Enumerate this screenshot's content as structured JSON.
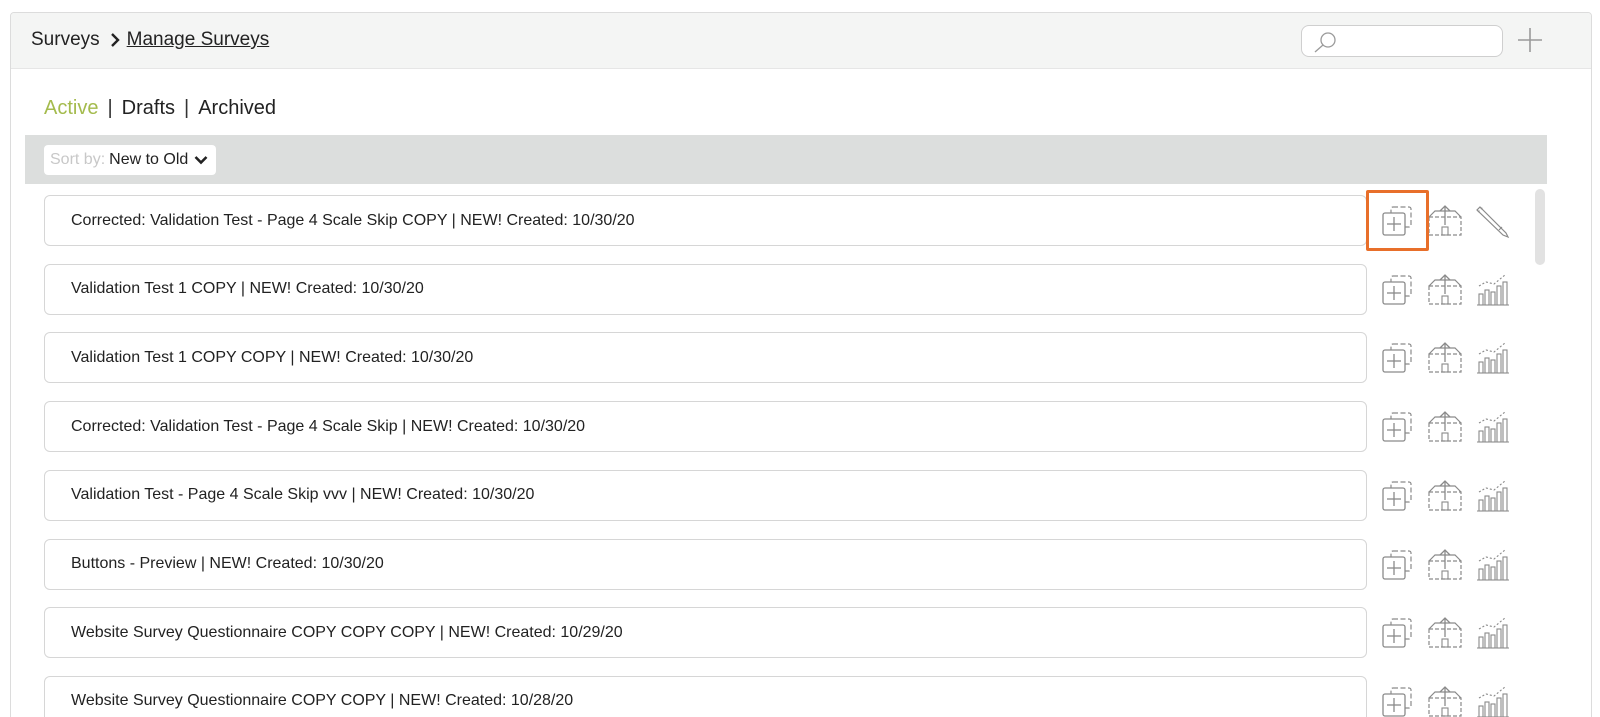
{
  "breadcrumb": {
    "parent": "Surveys",
    "current": "Manage Surveys"
  },
  "search": {
    "placeholder": "",
    "value": ""
  },
  "tabs": [
    {
      "label": "Active",
      "active": true
    },
    {
      "label": "Drafts",
      "active": false
    },
    {
      "label": "Archived",
      "active": false
    }
  ],
  "tab_separator": "|",
  "sort": {
    "label": "Sort by:",
    "value": "New to Old"
  },
  "surveys": [
    {
      "title": "Corrected: Validation Test - Page 4 Scale Skip COPY | NEW! Created: 10/30/20",
      "third_action": "edit"
    },
    {
      "title": "Validation Test 1 COPY | NEW! Created: 10/30/20",
      "third_action": "stats"
    },
    {
      "title": "Validation Test 1 COPY COPY | NEW! Created: 10/30/20",
      "third_action": "stats"
    },
    {
      "title": "Corrected: Validation Test - Page 4 Scale Skip | NEW! Created: 10/30/20",
      "third_action": "stats"
    },
    {
      "title": "Validation Test - Page 4 Scale Skip vvv | NEW! Created: 10/30/20",
      "third_action": "stats"
    },
    {
      "title": "Buttons - Preview | NEW! Created: 10/30/20",
      "third_action": "stats"
    },
    {
      "title": "Website Survey Questionnaire COPY COPY COPY | NEW! Created: 10/29/20",
      "third_action": "stats"
    },
    {
      "title": "Website Survey Questionnaire COPY COPY | NEW! Created: 10/28/20",
      "third_action": "stats"
    }
  ],
  "highlighted_action": "copy-survey-button",
  "colors": {
    "active_tab": "#a4bb4d",
    "highlight": "#e86f2a",
    "sort_bar": "#dcdedd",
    "icon": "#8a8a8a"
  },
  "icons": [
    "search-icon",
    "plus-icon",
    "chevron-right-icon",
    "chevron-down-icon",
    "copy-icon",
    "publish-icon",
    "pencil-icon",
    "bar-chart-icon"
  ]
}
